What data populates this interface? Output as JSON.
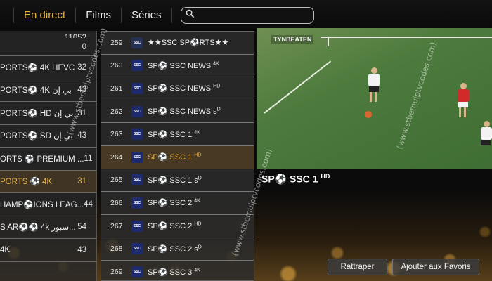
{
  "nav": {
    "items": [
      {
        "label": "En direct",
        "active": true
      },
      {
        "label": "Films",
        "active": false
      },
      {
        "label": "Séries",
        "active": false
      }
    ],
    "search_placeholder": ""
  },
  "categories": {
    "top_count": "11052",
    "items": [
      {
        "label": "",
        "count": "0"
      },
      {
        "label": "PORTS⚽ 4K HEVC",
        "count": "32"
      },
      {
        "label": "PORTS⚽ 4K بي إن",
        "count": "43"
      },
      {
        "label": "PORTS⚽ HD بي إن",
        "count": "31"
      },
      {
        "label": "PORTS⚽ SD بي إن",
        "count": "43"
      },
      {
        "label": "ORTS ⚽ PREMIUM ...",
        "count": "11"
      },
      {
        "label": "PORTS ⚽ 4K",
        "count": "31",
        "active": true
      },
      {
        "label": "HAMP⚽IONS LEAG...",
        "count": "44"
      },
      {
        "label": "S AR⚽⚽ 4k سبور...",
        "count": "54"
      },
      {
        "label": "4K",
        "count": "43"
      }
    ]
  },
  "channels": [
    {
      "num": "259",
      "name": "★★SSC SP⚽RTS★★",
      "sup": "",
      "logo": "dark"
    },
    {
      "num": "260",
      "name": "SP⚽ SSC NEWS ",
      "sup": "4K",
      "logo": "ssc"
    },
    {
      "num": "261",
      "name": "SP⚽ SSC NEWS ",
      "sup": "HD",
      "logo": "ssc"
    },
    {
      "num": "262",
      "name": "SP⚽ SSC NEWS s",
      "sup": "D",
      "logo": "ssc"
    },
    {
      "num": "263",
      "name": "SP⚽ SSC 1 ",
      "sup": "4K",
      "logo": "ssc"
    },
    {
      "num": "264",
      "name": "SP⚽ SSC 1 ",
      "sup": "HD",
      "logo": "ssc",
      "active": true
    },
    {
      "num": "265",
      "name": "SP⚽ SSC 1 s",
      "sup": "D",
      "logo": "ssc"
    },
    {
      "num": "266",
      "name": "SP⚽ SSC 2 ",
      "sup": "4K",
      "logo": "ssc"
    },
    {
      "num": "267",
      "name": "SP⚽ SSC 2 ",
      "sup": "HD",
      "logo": "ssc"
    },
    {
      "num": "268",
      "name": "SP⚽ SSC 2 s",
      "sup": "D",
      "logo": "ssc"
    },
    {
      "num": "269",
      "name": "SP⚽ SSC 3 ",
      "sup": "4K",
      "logo": "ssc"
    }
  ],
  "player": {
    "broadcaster": "TYNBEATEN",
    "now_title": "SP⚽ SSC 1 ",
    "now_title_sup": "HD"
  },
  "buttons": {
    "catchup": "Rattraper",
    "favorites": "Ajouter aux Favoris"
  },
  "watermark": "(www.stbemuiptvcodes.com)",
  "colors": {
    "accent": "#e8b54a",
    "background": "#0b0b0b",
    "panel": "#2d2d2d"
  }
}
